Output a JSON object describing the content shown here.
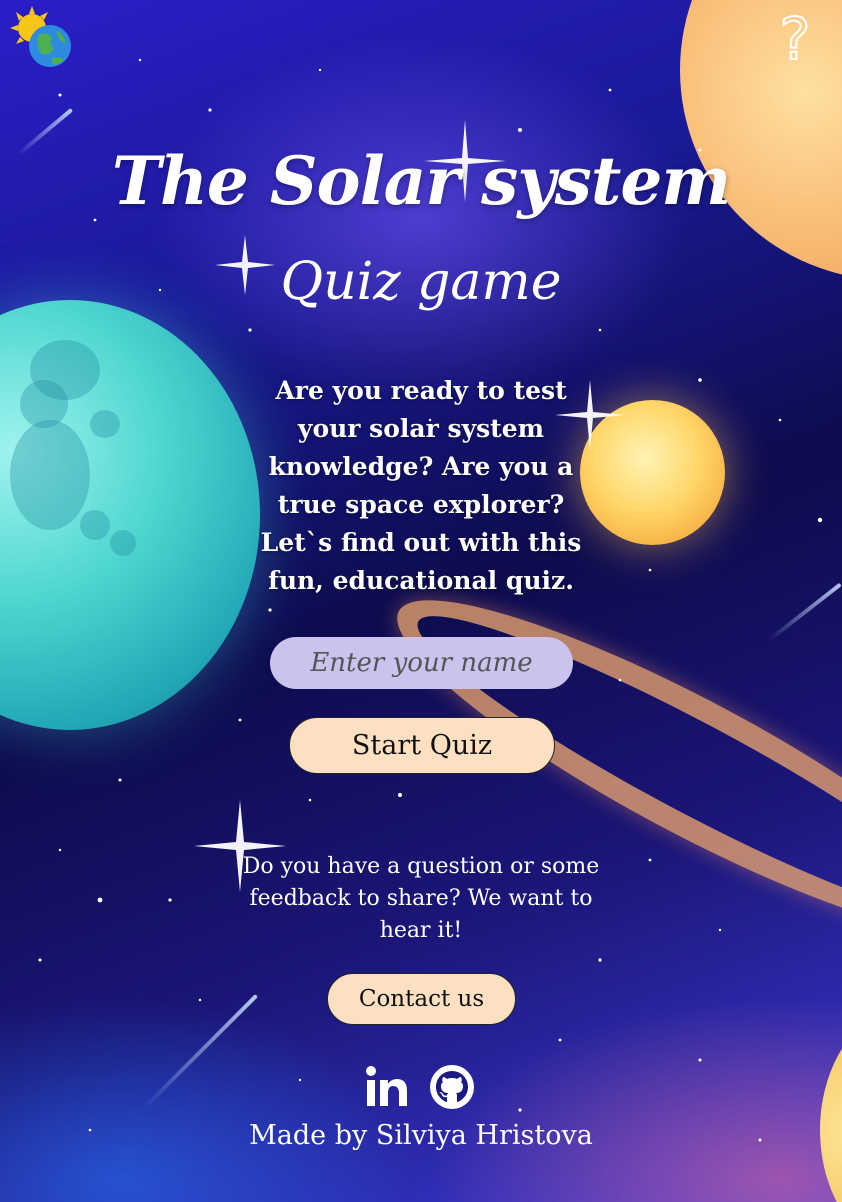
{
  "header": {
    "logo_icon": "sun-earth-icon",
    "help_icon": "question-mark-icon",
    "help_glyph": "?"
  },
  "hero": {
    "title": "The Solar system",
    "subtitle": "Quiz game",
    "intro": "Are you ready to test your solar system knowledge? Are you a true space explorer? Let`s find out with this fun, educational quiz."
  },
  "form": {
    "name_placeholder": "Enter your name",
    "name_value": "",
    "start_label": "Start Quiz"
  },
  "feedback": {
    "text": "Do you have a question or some feedback to share? We want to hear it!",
    "contact_label": "Contact us"
  },
  "footer": {
    "social_icons": [
      "linkedin-icon",
      "github-icon"
    ],
    "credit": "Made by Silviya Hristova"
  },
  "colors": {
    "input_bg": "#c9c3ee",
    "button_bg": "#fde0c2",
    "text": "#ffffff"
  }
}
